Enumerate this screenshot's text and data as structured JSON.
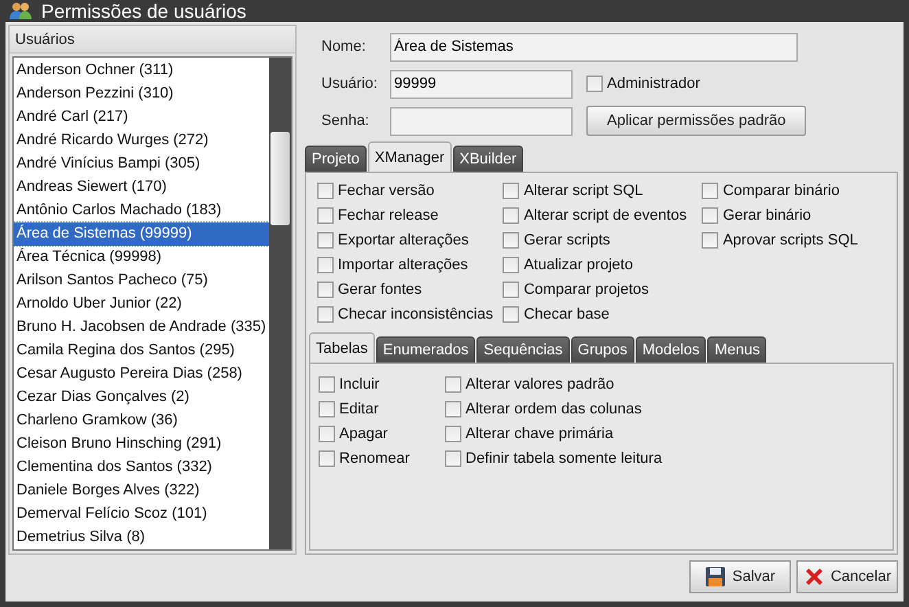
{
  "window": {
    "title": "Permissões de usuários"
  },
  "users": {
    "header": "Usuários",
    "items": [
      {
        "label": "Anderson Ochner (311)",
        "selected": false
      },
      {
        "label": "Anderson Pezzini (310)",
        "selected": false
      },
      {
        "label": "André Carl (217)",
        "selected": false
      },
      {
        "label": "André Ricardo Wurges (272)",
        "selected": false
      },
      {
        "label": "André Vinícius Bampi (305)",
        "selected": false
      },
      {
        "label": "Andreas Siewert (170)",
        "selected": false
      },
      {
        "label": "Antônio Carlos Machado (183)",
        "selected": false
      },
      {
        "label": "Área de Sistemas (99999)",
        "selected": true
      },
      {
        "label": "Área Técnica (99998)",
        "selected": false
      },
      {
        "label": "Arilson Santos Pacheco (75)",
        "selected": false
      },
      {
        "label": "Arnoldo Uber Junior (22)",
        "selected": false
      },
      {
        "label": "Bruno H. Jacobsen de Andrade (335)",
        "selected": false
      },
      {
        "label": "Camila Regina dos Santos (295)",
        "selected": false
      },
      {
        "label": "Cesar Augusto Pereira Dias (258)",
        "selected": false
      },
      {
        "label": "Cezar Dias Gonçalves (2)",
        "selected": false
      },
      {
        "label": "Charleno Gramkow (36)",
        "selected": false
      },
      {
        "label": "Cleison Bruno Hinsching (291)",
        "selected": false
      },
      {
        "label": "Clementina dos Santos (332)",
        "selected": false
      },
      {
        "label": "Daniele Borges Alves (322)",
        "selected": false
      },
      {
        "label": "Demerval Felício Scoz (101)",
        "selected": false
      },
      {
        "label": "Demetrius Silva (8)",
        "selected": false
      }
    ]
  },
  "form": {
    "name_label": "Nome:",
    "name_value": "Área de Sistemas",
    "user_label": "Usuário:",
    "user_value": "99999",
    "admin": {
      "label": "Administrador",
      "checked": false
    },
    "password_label": "Senha:",
    "apply_button": "Aplicar permissões padrão"
  },
  "tabs": [
    {
      "label": "Projeto",
      "selected": false
    },
    {
      "label": "XManager",
      "selected": true
    },
    {
      "label": "XBuilder",
      "selected": false
    }
  ],
  "permissions": [
    [
      {
        "label": "Fechar versão",
        "checked": false
      },
      {
        "label": "Fechar release",
        "checked": false
      },
      {
        "label": "Exportar alterações",
        "checked": false
      },
      {
        "label": "Importar alterações",
        "checked": false
      },
      {
        "label": "Gerar fontes",
        "checked": false
      },
      {
        "label": "Checar inconsistências",
        "checked": false
      }
    ],
    [
      {
        "label": "Alterar script SQL",
        "checked": false
      },
      {
        "label": "Alterar script de eventos",
        "checked": false
      },
      {
        "label": "Gerar scripts",
        "checked": false
      },
      {
        "label": "Atualizar projeto",
        "checked": false
      },
      {
        "label": "Comparar projetos",
        "checked": false
      },
      {
        "label": "Checar base",
        "checked": false
      }
    ],
    [
      {
        "label": "Comparar binário",
        "checked": false
      },
      {
        "label": "Gerar binário",
        "checked": false
      },
      {
        "label": "Aprovar scripts SQL",
        "checked": false
      }
    ]
  ],
  "subtabs": [
    {
      "label": "Tabelas",
      "selected": true
    },
    {
      "label": "Enumerados",
      "selected": false
    },
    {
      "label": "Sequências",
      "selected": false
    },
    {
      "label": "Grupos",
      "selected": false
    },
    {
      "label": "Modelos",
      "selected": false
    },
    {
      "label": "Menus",
      "selected": false
    }
  ],
  "table_permissions": [
    [
      {
        "label": "Incluir",
        "checked": false
      },
      {
        "label": "Editar",
        "checked": false
      },
      {
        "label": "Apagar",
        "checked": false
      },
      {
        "label": "Renomear",
        "checked": false
      }
    ],
    [
      {
        "label": "Alterar valores padrão",
        "checked": false
      },
      {
        "label": "Alterar ordem das colunas",
        "checked": false
      },
      {
        "label": "Alterar chave primária",
        "checked": false
      },
      {
        "label": "Definir tabela somente leitura",
        "checked": false
      }
    ]
  ],
  "buttons": [
    {
      "kind": "save",
      "label": "Salvar"
    },
    {
      "kind": "cancel",
      "label": "Cancelar"
    }
  ]
}
